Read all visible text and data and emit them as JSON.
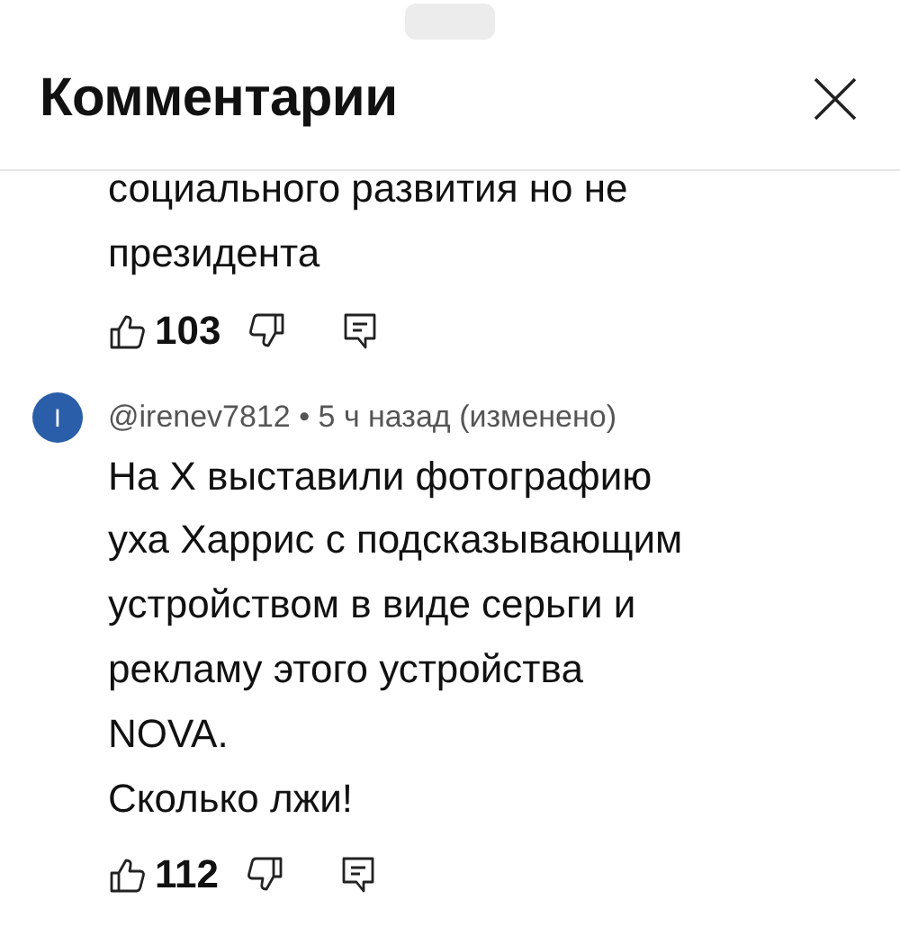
{
  "header": {
    "title": "Комментарии"
  },
  "comments": [
    {
      "lines": [
        "социального развития но не",
        "президента"
      ],
      "likes": "103"
    },
    {
      "avatar_letter": "I",
      "color": "#2a5ea8",
      "meta": "@irenev7812 • 5 ч назад (изменено)",
      "lines": [
        "На X выставили фотографию",
        "уха Харрис с подсказывающим",
        "устройством в виде серьги и",
        "рекламу этого устройства",
        "NOVA.",
        "Сколько лжи!"
      ],
      "likes": "112"
    }
  ]
}
